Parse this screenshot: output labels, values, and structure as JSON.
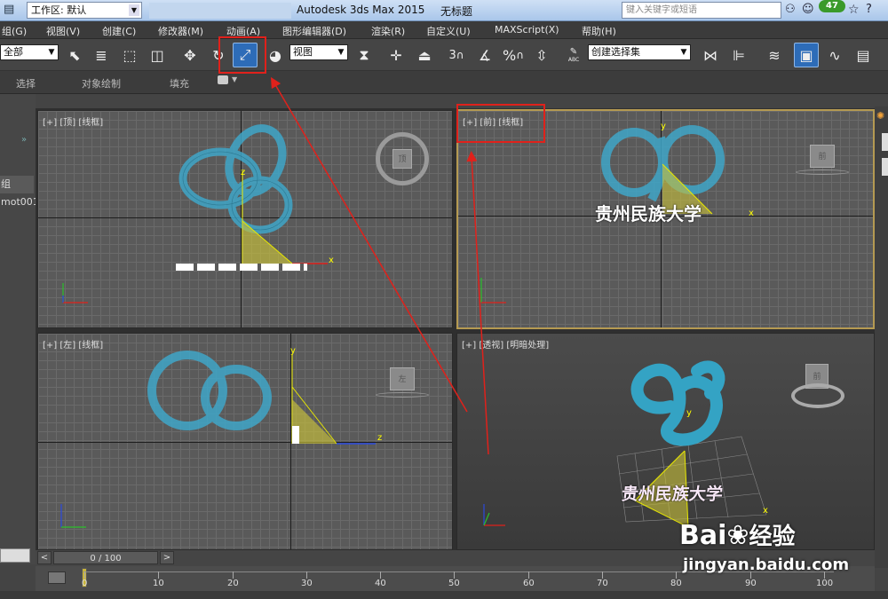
{
  "titlebar": {
    "workspace": "工作区: 默认",
    "app_title": "Autodesk 3ds Max  2015",
    "doc_title": "无标题",
    "search_placeholder": "键入关键字或短语",
    "badge": "47"
  },
  "menu": [
    "组(G)",
    "视图(V)",
    "创建(C)",
    "修改器(M)",
    "动画(A)",
    "图形编辑器(D)",
    "渲染(R)",
    "自定义(U)",
    "MAXScript(X)",
    "帮助(H)"
  ],
  "toolbar": {
    "filter_value": "全部",
    "ref_coord_value": "视图",
    "selection_set_value": "创建选择集",
    "snap_label": "3",
    "percent_label": "%",
    "abc_label": "ABC"
  },
  "ribbon": {
    "tabs": [
      "选择",
      "对象绘制",
      "填充"
    ]
  },
  "left_panel": {
    "items": [
      "组",
      "mot001"
    ]
  },
  "viewports": {
    "top": "[+] [顶] [线框]",
    "front": "[+] [前] [线框]",
    "left": "[+] [左] [线框]",
    "persp": "[+] [透视] [明暗处理]",
    "cube_top": "顶",
    "cube_front": "前",
    "cube_left": "左",
    "cube_persp": "前"
  },
  "scene_text": "贵州民族大学",
  "axes": {
    "x": "x",
    "y": "y",
    "z": "z"
  },
  "timeline": {
    "frame_display": "0 / 100",
    "ticks": [
      "0",
      "10",
      "20",
      "30",
      "40",
      "50",
      "60",
      "70",
      "80",
      "90",
      "100"
    ]
  },
  "watermark": {
    "brand": "Bai",
    "brand_suffix": "经验",
    "url": "jingyan.baidu.com"
  },
  "colors": {
    "accent_active": "#2d6cb8",
    "annotation": "#e0211b",
    "wire": "#3fa6c8",
    "active_viewport_border": "#b59a52"
  }
}
